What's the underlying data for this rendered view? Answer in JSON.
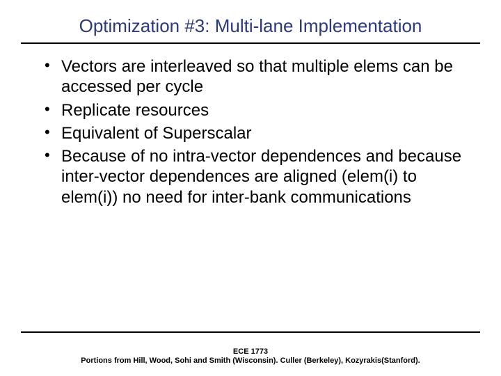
{
  "title": "Optimization #3: Multi-lane Implementation",
  "bullets": [
    "Vectors are interleaved so that multiple elems can be accessed per cycle",
    "Replicate resources",
    "Equivalent of Superscalar",
    "Because of no intra-vector dependences and because inter-vector dependences are aligned (elem(i) to elem(i)) no need for inter-bank communications"
  ],
  "footer": {
    "line1": "ECE 1773",
    "line2": "Portions from Hill, Wood, Sohi and Smith (Wisconsin). Culler (Berkeley), Kozyrakis(Stanford)."
  }
}
